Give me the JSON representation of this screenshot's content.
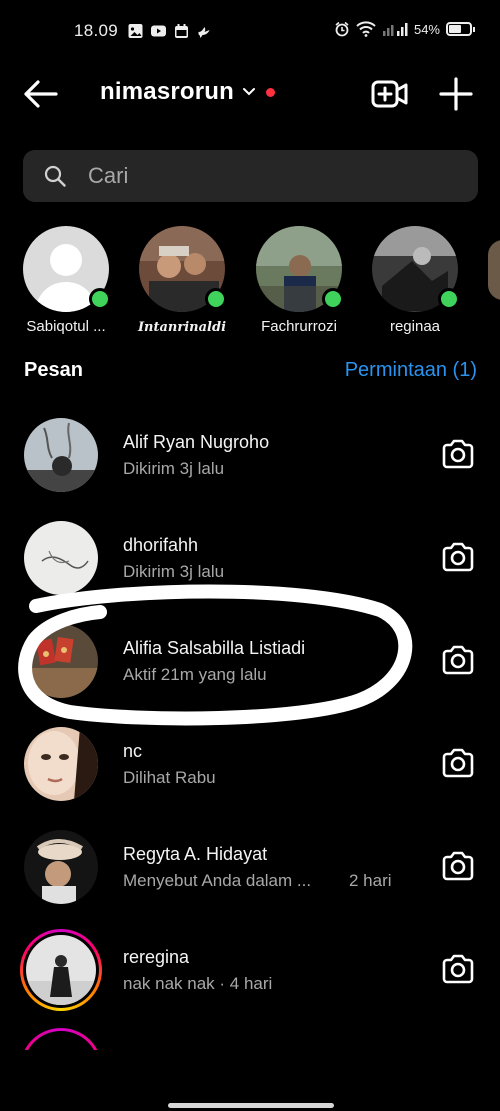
{
  "status_bar": {
    "time": "18.09",
    "battery": "54%",
    "battery_level": 0.54,
    "icons": [
      "gallery-icon",
      "youtube-icon",
      "calendar-icon",
      "bird-icon",
      "alarm-icon",
      "wifi-icon",
      "signal-icon",
      "battery-icon"
    ]
  },
  "header": {
    "username": "nimasrorun",
    "has_notification_dot": true
  },
  "search": {
    "placeholder": "Cari"
  },
  "stories": [
    {
      "name": "Sabiqotul ...",
      "online": true
    },
    {
      "name": "Intanrinaldi",
      "online": true
    },
    {
      "name": "Fachrurrozi",
      "online": true
    },
    {
      "name": "reginaa",
      "online": true
    }
  ],
  "messages_section": {
    "title": "Pesan",
    "requests_label": "Permintaan (1)"
  },
  "conversations": [
    {
      "name": "Alif Ryan Nugroho",
      "status": "Dikirim 3j lalu",
      "time": ""
    },
    {
      "name": "dhorifahh",
      "status": "Dikirim 3j lalu",
      "time": ""
    },
    {
      "name": "Alifia Salsabilla Listiadi",
      "status": "Aktif 21m yang lalu",
      "time": ""
    },
    {
      "name": "nc",
      "status": "Dilihat Rabu",
      "time": ""
    },
    {
      "name": "Regyta A. Hidayat",
      "status": "Menyebut Anda dalam ...",
      "time": "2 hari"
    },
    {
      "name": "reregina",
      "status": "nak nak nak · 4 hari",
      "time": ""
    }
  ],
  "colors": {
    "background": "#000000",
    "accent_link": "#2a93ef",
    "online": "#3fd35b",
    "notification_dot": "#ff3040",
    "search_bg": "#262626",
    "secondary_text": "#a8a8a8"
  }
}
